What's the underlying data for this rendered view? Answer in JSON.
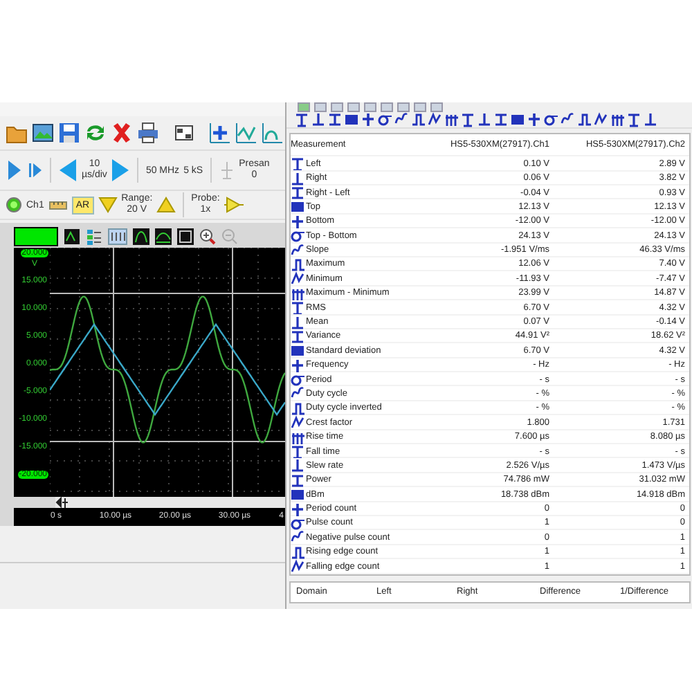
{
  "main_window": {
    "timebase": {
      "value": "10",
      "unit": "µs/div"
    },
    "sample_frequency": "50 MHz",
    "record_length": "5 kS",
    "pre_samples": {
      "label": "Presan",
      "value": "0"
    },
    "channel": {
      "name": "Ch1",
      "enabled": true,
      "auto_range": {
        "label": "AR",
        "selected": true
      },
      "range_label": "Range:",
      "range_value": "20 V",
      "probe_label": "Probe:",
      "probe_value": "1x"
    },
    "scope": {
      "y_unit": "V",
      "y_labels": [
        {
          "text": "20.000",
          "highlighted": true
        },
        {
          "text": "15.000",
          "highlighted": false
        },
        {
          "text": "10.000",
          "highlighted": false
        },
        {
          "text": "5.000",
          "highlighted": false
        },
        {
          "text": "0.000",
          "highlighted": false
        },
        {
          "text": "-5.000",
          "highlighted": false
        },
        {
          "text": "-10.000",
          "highlighted": false
        },
        {
          "text": "-15.000",
          "highlighted": false
        },
        {
          "text": "-20.000",
          "highlighted": true
        }
      ],
      "x_labels": [
        "0 s",
        "10.00 µs",
        "20.00 µs",
        "30.00 µs",
        "4"
      ]
    }
  },
  "measurements": {
    "columns": [
      "Measurement",
      "HS5-530XM(27917).Ch1",
      "HS5-530XM(27917).Ch2"
    ],
    "rows": [
      {
        "name": "Left",
        "ch1": "0.10 V",
        "ch2": "2.89 V"
      },
      {
        "name": "Right",
        "ch1": "0.06 V",
        "ch2": "3.82 V"
      },
      {
        "name": "Right - Left",
        "ch1": "-0.04 V",
        "ch2": "0.93 V"
      },
      {
        "name": "Top",
        "ch1": "12.13 V",
        "ch2": "12.13 V"
      },
      {
        "name": "Bottom",
        "ch1": "-12.00 V",
        "ch2": "-12.00 V"
      },
      {
        "name": "Top - Bottom",
        "ch1": "24.13 V",
        "ch2": "24.13 V"
      },
      {
        "name": "Slope",
        "ch1": "-1.951 V/ms",
        "ch2": "46.33 V/ms"
      },
      {
        "name": "Maximum",
        "ch1": "12.06 V",
        "ch2": "7.40 V"
      },
      {
        "name": "Minimum",
        "ch1": "-11.93 V",
        "ch2": "-7.47 V"
      },
      {
        "name": "Maximum - Minimum",
        "ch1": "23.99 V",
        "ch2": "14.87 V"
      },
      {
        "name": "RMS",
        "ch1": "6.70 V",
        "ch2": "4.32 V"
      },
      {
        "name": "Mean",
        "ch1": "0.07 V",
        "ch2": "-0.14 V"
      },
      {
        "name": "Variance",
        "ch1": "44.91 V²",
        "ch2": "18.62 V²"
      },
      {
        "name": "Standard deviation",
        "ch1": "6.70 V",
        "ch2": "4.32 V"
      },
      {
        "name": "Frequency",
        "ch1": "- Hz",
        "ch2": "- Hz"
      },
      {
        "name": "Period",
        "ch1": "- s",
        "ch2": "- s"
      },
      {
        "name": "Duty cycle",
        "ch1": "- %",
        "ch2": "- %"
      },
      {
        "name": "Duty cycle inverted",
        "ch1": "- %",
        "ch2": "- %"
      },
      {
        "name": "Crest factor",
        "ch1": "1.800",
        "ch2": "1.731"
      },
      {
        "name": "Rise time",
        "ch1": "7.600 µs",
        "ch2": "8.080 µs"
      },
      {
        "name": "Fall time",
        "ch1": "- s",
        "ch2": "- s"
      },
      {
        "name": "Slew rate",
        "ch1": "2.526 V/µs",
        "ch2": "1.473 V/µs"
      },
      {
        "name": "Power",
        "ch1": "74.786 mW",
        "ch2": "31.032 mW"
      },
      {
        "name": "dBm",
        "ch1": "18.738 dBm",
        "ch2": "14.918 dBm"
      },
      {
        "name": "Period count",
        "ch1": "0",
        "ch2": "0"
      },
      {
        "name": "Pulse count",
        "ch1": "1",
        "ch2": "0"
      },
      {
        "name": "Negative pulse count",
        "ch1": "0",
        "ch2": "1"
      },
      {
        "name": "Rising edge count",
        "ch1": "1",
        "ch2": "1"
      },
      {
        "name": "Falling edge count",
        "ch1": "1",
        "ch2": "1"
      }
    ]
  },
  "cursor_table": {
    "columns": [
      "Domain",
      "Left",
      "Right",
      "Difference",
      "1/Difference"
    ]
  }
}
